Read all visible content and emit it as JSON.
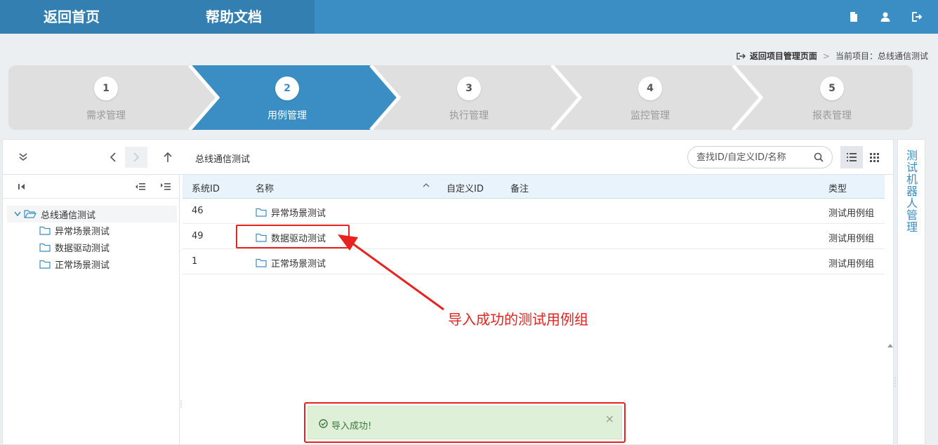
{
  "topnav": {
    "home_label": "返回首页",
    "help_label": "帮助文档",
    "icons": [
      "document-icon",
      "user-icon",
      "logout-icon"
    ]
  },
  "breadcrumb": {
    "back_label": "返回项目管理页面",
    "separator": ">",
    "current_label": "当前项目：总线通信测试"
  },
  "steps": [
    {
      "num": "1",
      "label": "需求管理",
      "active": false
    },
    {
      "num": "2",
      "label": "用例管理",
      "active": true
    },
    {
      "num": "3",
      "label": "执行管理",
      "active": false
    },
    {
      "num": "4",
      "label": "监控管理",
      "active": false
    },
    {
      "num": "5",
      "label": "报表管理",
      "active": false
    }
  ],
  "toolbar": {
    "title": "总线通信测试",
    "search_placeholder": "查找ID/自定义ID/名称"
  },
  "tree": {
    "root": "总线通信测试",
    "children": [
      "异常场景测试",
      "数据驱动测试",
      "正常场景测试"
    ]
  },
  "table": {
    "headers": {
      "id": "系统ID",
      "name": "名称",
      "custom_id": "自定义ID",
      "note": "备注",
      "type": "类型"
    },
    "rows": [
      {
        "id": "46",
        "name": "异常场景测试",
        "type": "测试用例组"
      },
      {
        "id": "49",
        "name": "数据驱动测试",
        "type": "测试用例组"
      },
      {
        "id": "1",
        "name": "正常场景测试",
        "type": "测试用例组"
      }
    ]
  },
  "side_tab": {
    "label": "测试机器人管理"
  },
  "annotation": {
    "text": "导入成功的测试用例组"
  },
  "toast": {
    "message": "导入成功!",
    "close": "×"
  },
  "colors": {
    "primary": "#3a8ec4",
    "annotation_red": "#e8231f",
    "toast_green": "#dff0d8"
  }
}
